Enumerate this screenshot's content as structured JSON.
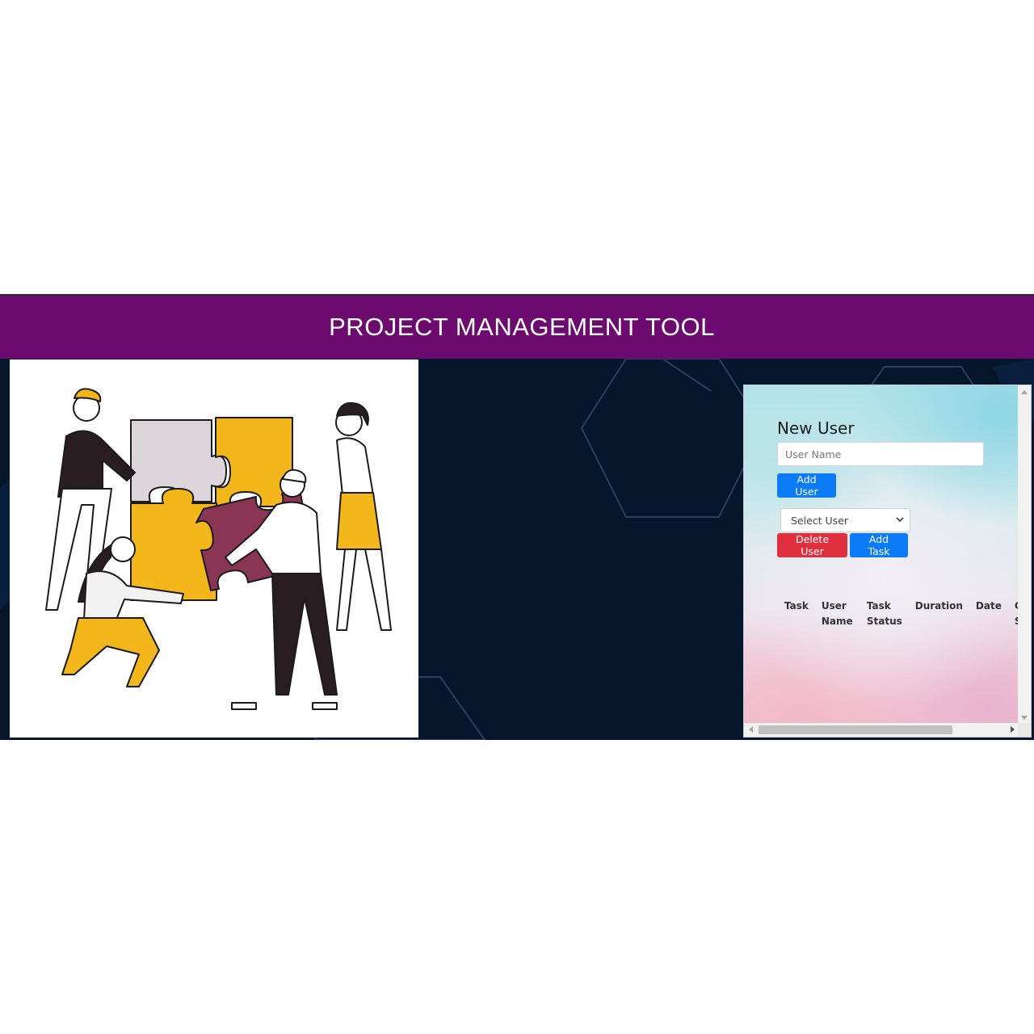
{
  "header": {
    "title": "PROJECT MANAGEMENT TOOL"
  },
  "new_user_form": {
    "title": "New User",
    "name_placeholder": "User Name",
    "add_user_label": "Add User"
  },
  "user_select": {
    "selected": "Select User"
  },
  "actions": {
    "delete_user_label": "Delete User",
    "add_task_label": "Add Task"
  },
  "task_table": {
    "columns": [
      "Task",
      "User Name",
      "Task Status",
      "Duration",
      "Date",
      "C S"
    ]
  },
  "illustration": {
    "icon": "team-puzzle-illustration"
  },
  "colors": {
    "header_bg": "#6c0a70",
    "stage_bg": "#05162d",
    "primary_button": "#0b7bf6",
    "danger_button": "#e0303f"
  }
}
